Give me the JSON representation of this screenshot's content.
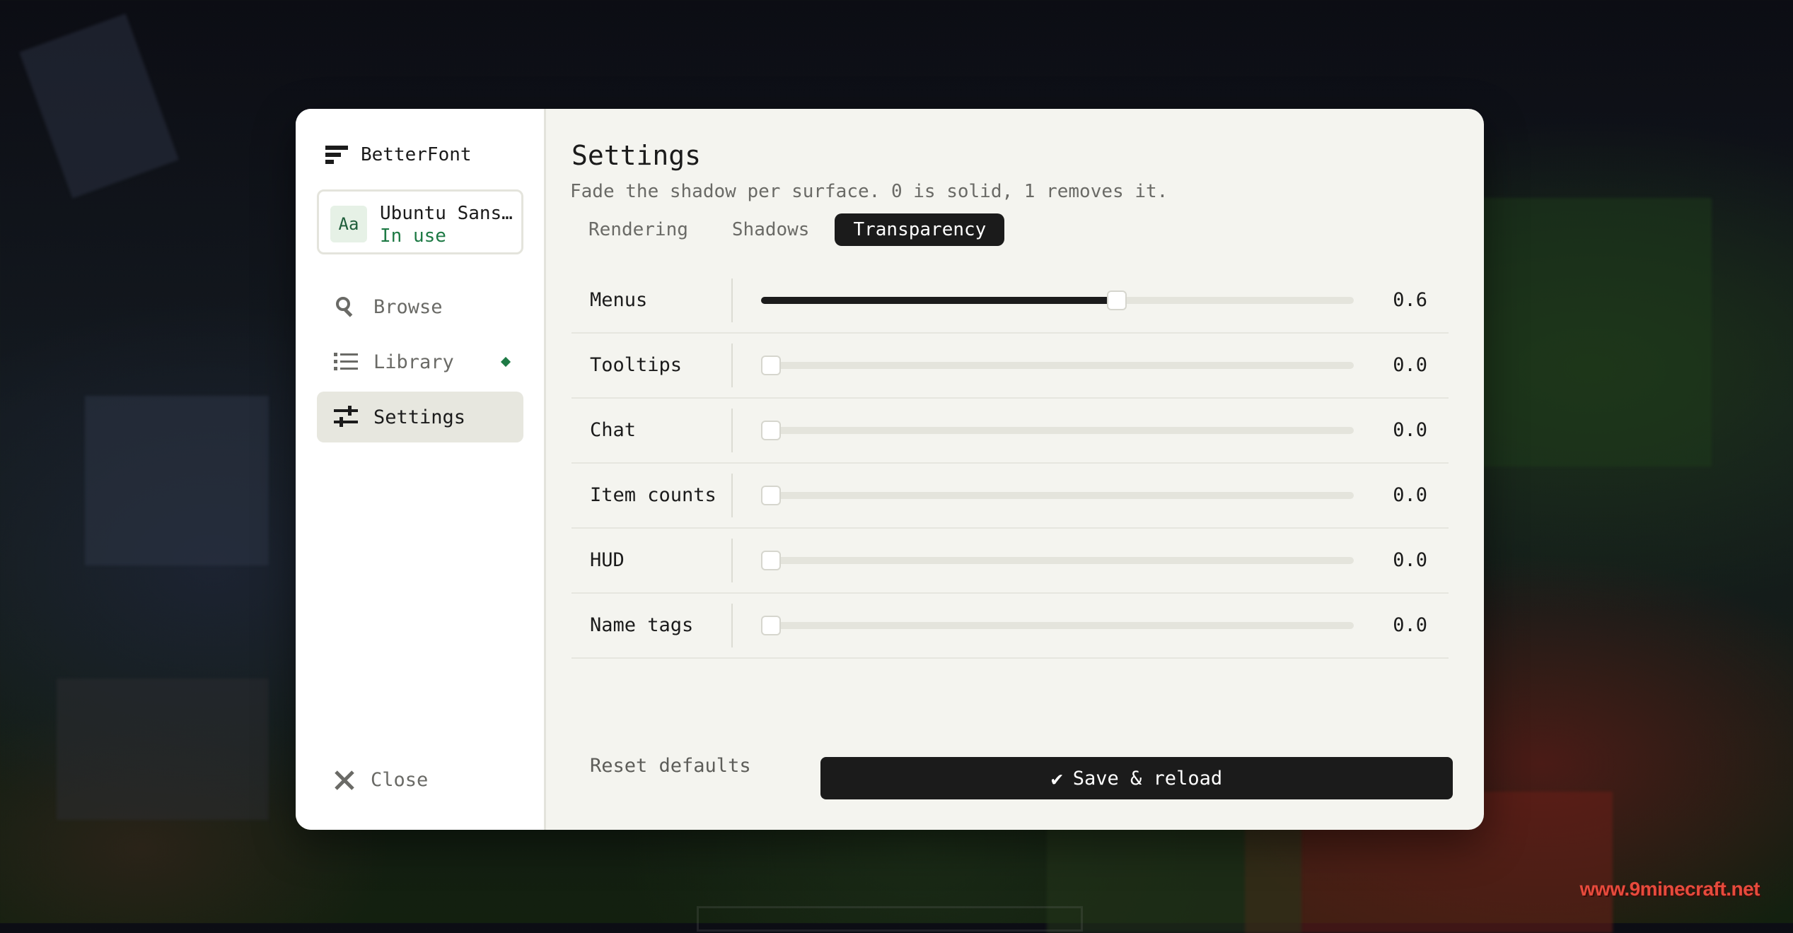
{
  "app": {
    "name": "BetterFont",
    "watermark": "www.9minecraft.net"
  },
  "current_font": {
    "avatar": "Aa",
    "name": "Ubuntu Sans…",
    "status": "In use"
  },
  "nav": {
    "browse": {
      "label": "Browse",
      "icon": "search-icon"
    },
    "library": {
      "label": "Library",
      "icon": "list-icon",
      "has_indicator": true
    },
    "settings": {
      "label": "Settings",
      "icon": "sliders-icon",
      "active": true
    },
    "close": {
      "label": "Close",
      "icon": "close-icon"
    }
  },
  "page": {
    "title": "Settings",
    "subtitle": "Fade the shadow per surface. 0 is solid, 1 removes it."
  },
  "tabs": [
    {
      "label": "Rendering",
      "active": false
    },
    {
      "label": "Shadows",
      "active": false
    },
    {
      "label": "Transparency",
      "active": true
    }
  ],
  "sliders": [
    {
      "label": "Menus",
      "value": 0.6,
      "display": "0.6"
    },
    {
      "label": "Tooltips",
      "value": 0.0,
      "display": "0.0"
    },
    {
      "label": "Chat",
      "value": 0.0,
      "display": "0.0"
    },
    {
      "label": "Item counts",
      "value": 0.0,
      "display": "0.0"
    },
    {
      "label": "HUD",
      "value": 0.0,
      "display": "0.0"
    },
    {
      "label": "Name tags",
      "value": 0.0,
      "display": "0.0"
    }
  ],
  "actions": {
    "reset_label": "Reset defaults",
    "save_label": "Save & reload",
    "save_icon": "check-icon"
  },
  "colors": {
    "accent": "#1b1b1b",
    "status_green": "#1e7a45",
    "panel_bg": "#f4f4ef"
  }
}
